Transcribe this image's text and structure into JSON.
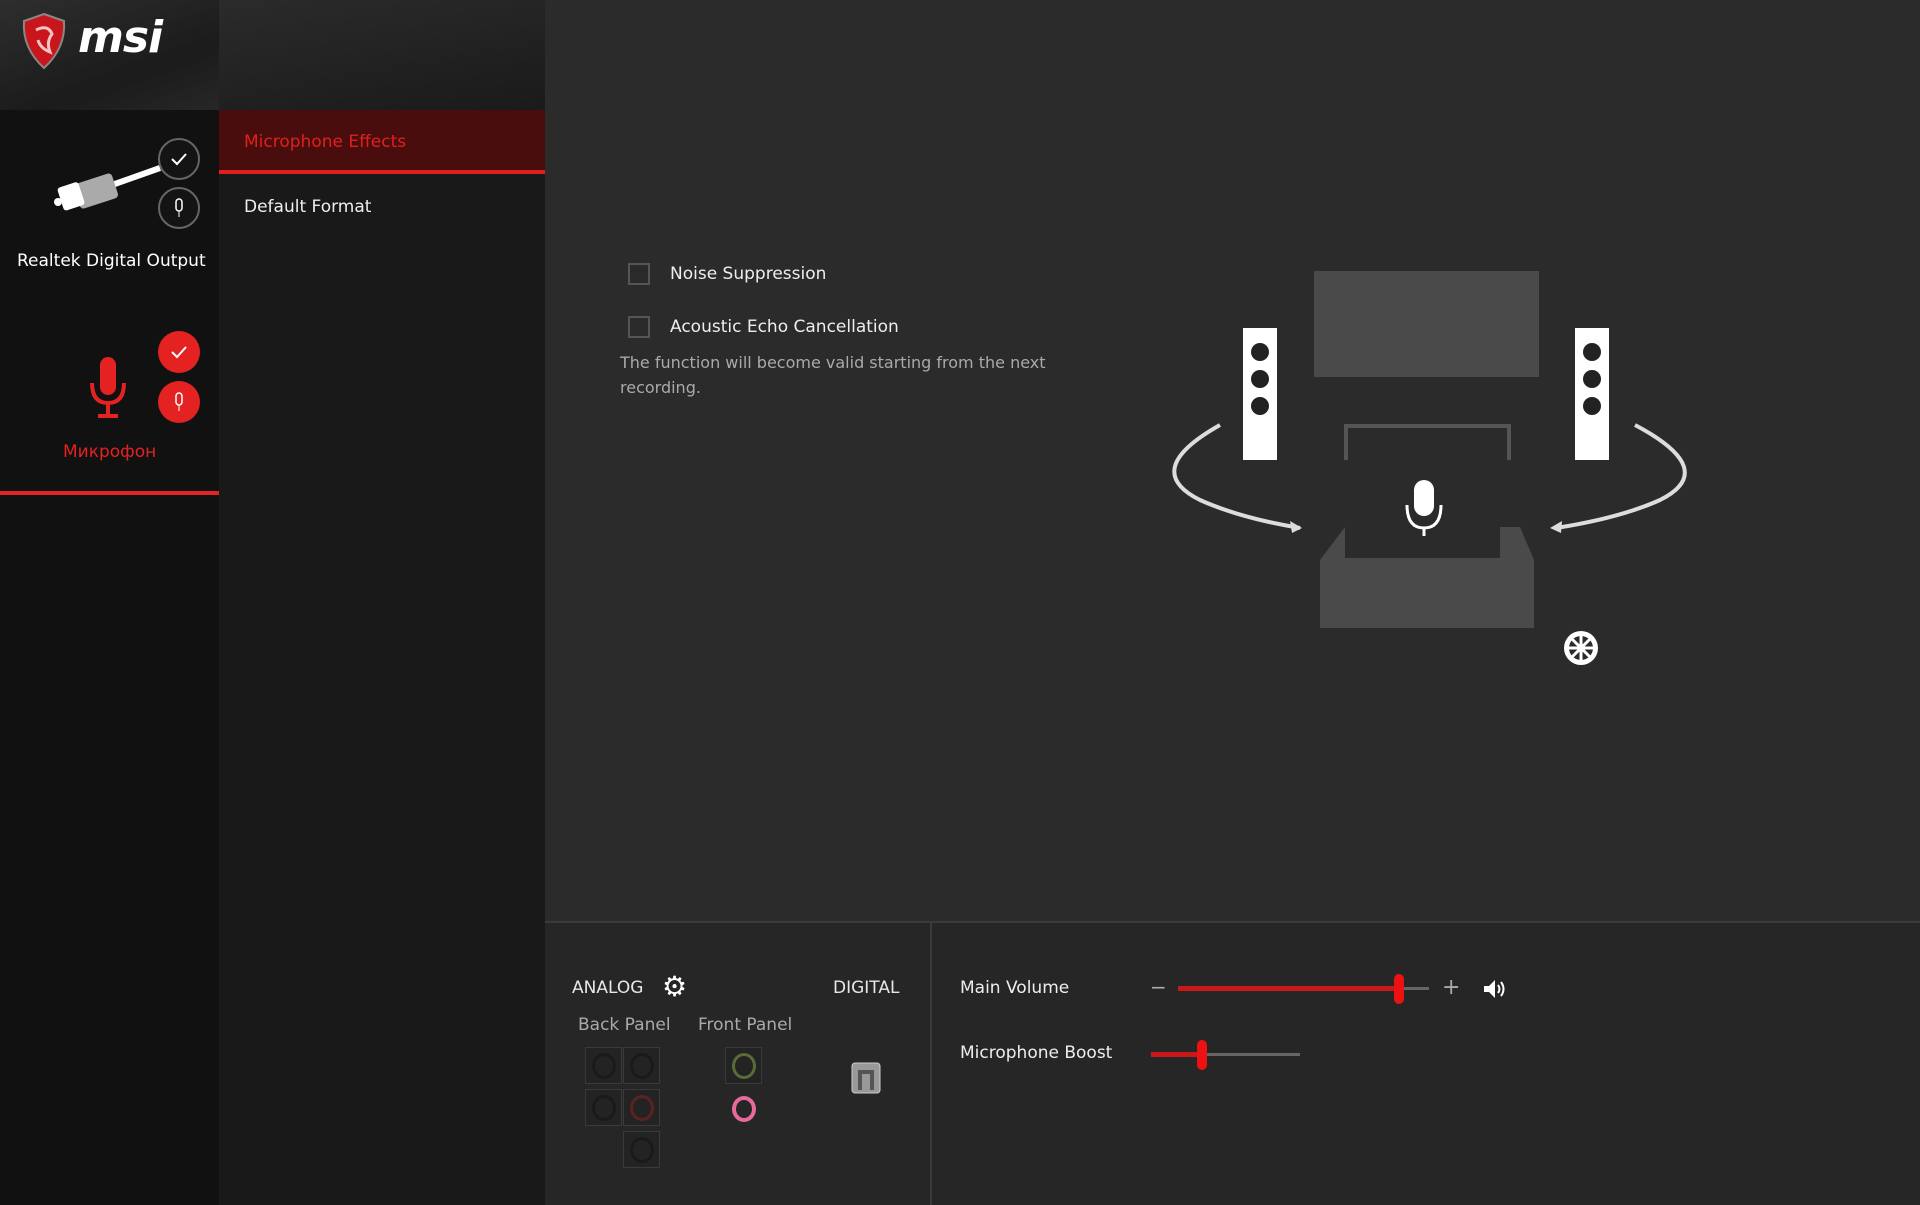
{
  "brand": "msi",
  "window_controls": {
    "info_icon": "info-icon",
    "settings_icon": "gear-icon",
    "minimize": "–",
    "maximize": "☐",
    "close": "✕"
  },
  "devices": [
    {
      "label": "Realtek Digital Output",
      "icon": "digital-cable-icon",
      "active": false
    },
    {
      "label": "Микрофон",
      "icon": "microphone-icon",
      "active": true
    }
  ],
  "submenu": {
    "items": [
      {
        "label": "Microphone Effects",
        "selected": true
      },
      {
        "label": "Default Format",
        "selected": false
      }
    ]
  },
  "effects": {
    "noise_suppression": {
      "label": "Noise Suppression",
      "checked": false
    },
    "echo_cancellation": {
      "label": "Acoustic Echo Cancellation",
      "checked": false
    },
    "note": "The function will become valid starting from the next recording."
  },
  "connectors": {
    "analog_label": "ANALOG",
    "digital_label": "DIGITAL",
    "back_panel_label": "Back Panel",
    "front_panel_label": "Front Panel",
    "front_jack_colors": [
      "#5a6a3a",
      "#e86a9a"
    ]
  },
  "volume": {
    "main_label": "Main Volume",
    "main_value_percent": 88,
    "minus": "−",
    "plus": "+",
    "boost_label": "Microphone Boost",
    "boost_value_percent": 34
  },
  "colors": {
    "accent": "#e42222"
  }
}
